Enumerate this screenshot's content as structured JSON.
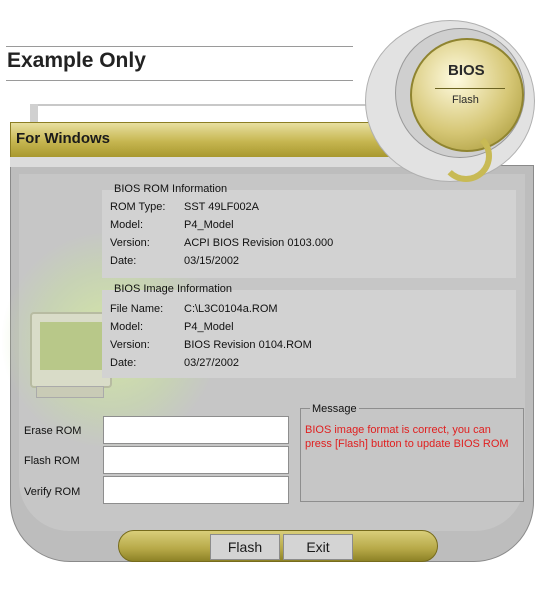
{
  "header": {
    "title": "Example Only"
  },
  "banner": {
    "label": "For Windows"
  },
  "logo": {
    "title": "BIOS",
    "subtitle": "Flash"
  },
  "rom_info": {
    "title": "BIOS ROM Information",
    "rows": [
      {
        "label": "ROM Type:",
        "value": "SST 49LF002A"
      },
      {
        "label": "Model:",
        "value": "P4_Model"
      },
      {
        "label": "Version:",
        "value": "ACPI BIOS Revision 0103.000"
      },
      {
        "label": "Date:",
        "value": "03/15/2002"
      }
    ]
  },
  "image_info": {
    "title": "BIOS Image Information",
    "rows": [
      {
        "label": "File Name:",
        "value": "C:\\L3C0104a.ROM"
      },
      {
        "label": "Model:",
        "value": "P4_Model"
      },
      {
        "label": "Version:",
        "value": "BIOS Revision 0104.ROM"
      },
      {
        "label": "Date:",
        "value": "03/27/2002"
      }
    ]
  },
  "progress": {
    "erase_label": "Erase ROM",
    "flash_label": "Flash ROM",
    "verify_label": "Verify ROM"
  },
  "message": {
    "title": "Message",
    "text": "BIOS image format is correct, you can press [Flash] button to update BIOS ROM"
  },
  "buttons": {
    "flash": "Flash",
    "exit": "Exit"
  },
  "colors": {
    "accent_gold": "#c6b650",
    "message_text": "#e02020"
  }
}
